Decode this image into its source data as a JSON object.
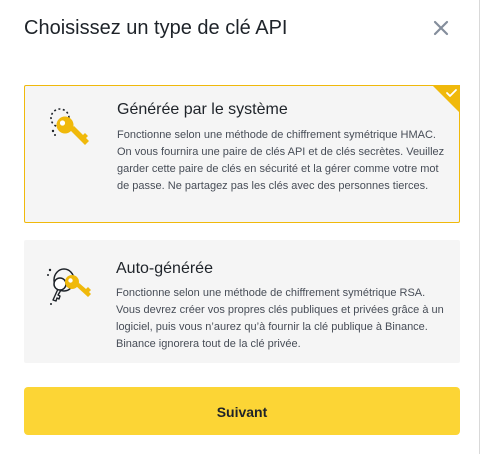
{
  "dialog": {
    "title": "Choisissez un type de clé API"
  },
  "options": [
    {
      "title": "Générée par le système",
      "description": "Fonctionne selon une méthode de chiffrement symétrique HMAC. On vous fournira une paire de clés API et de clés secrètes. Veuillez garder cette paire de clés en sécurité et la gérer comme votre mot de passe. Ne partagez pas les clés avec des personnes tierces.",
      "selected": true,
      "icon": "key-icon"
    },
    {
      "title": "Auto-générée",
      "description": "Fonctionne selon une méthode de chiffrement symétrique RSA. Vous devrez créer vos propres clés publiques et privées grâce à un logiciel, puis vous n’aurez qu’à fournir la clé publique à Binance. Binance ignorera tout de la clé privée.",
      "selected": false,
      "icon": "keys-icon"
    }
  ],
  "actions": {
    "next_label": "Suivant"
  },
  "colors": {
    "accent": "#fcd535",
    "selected_border": "#f0b90b",
    "card_bg": "#f5f5f5",
    "text": "#1e2329"
  }
}
